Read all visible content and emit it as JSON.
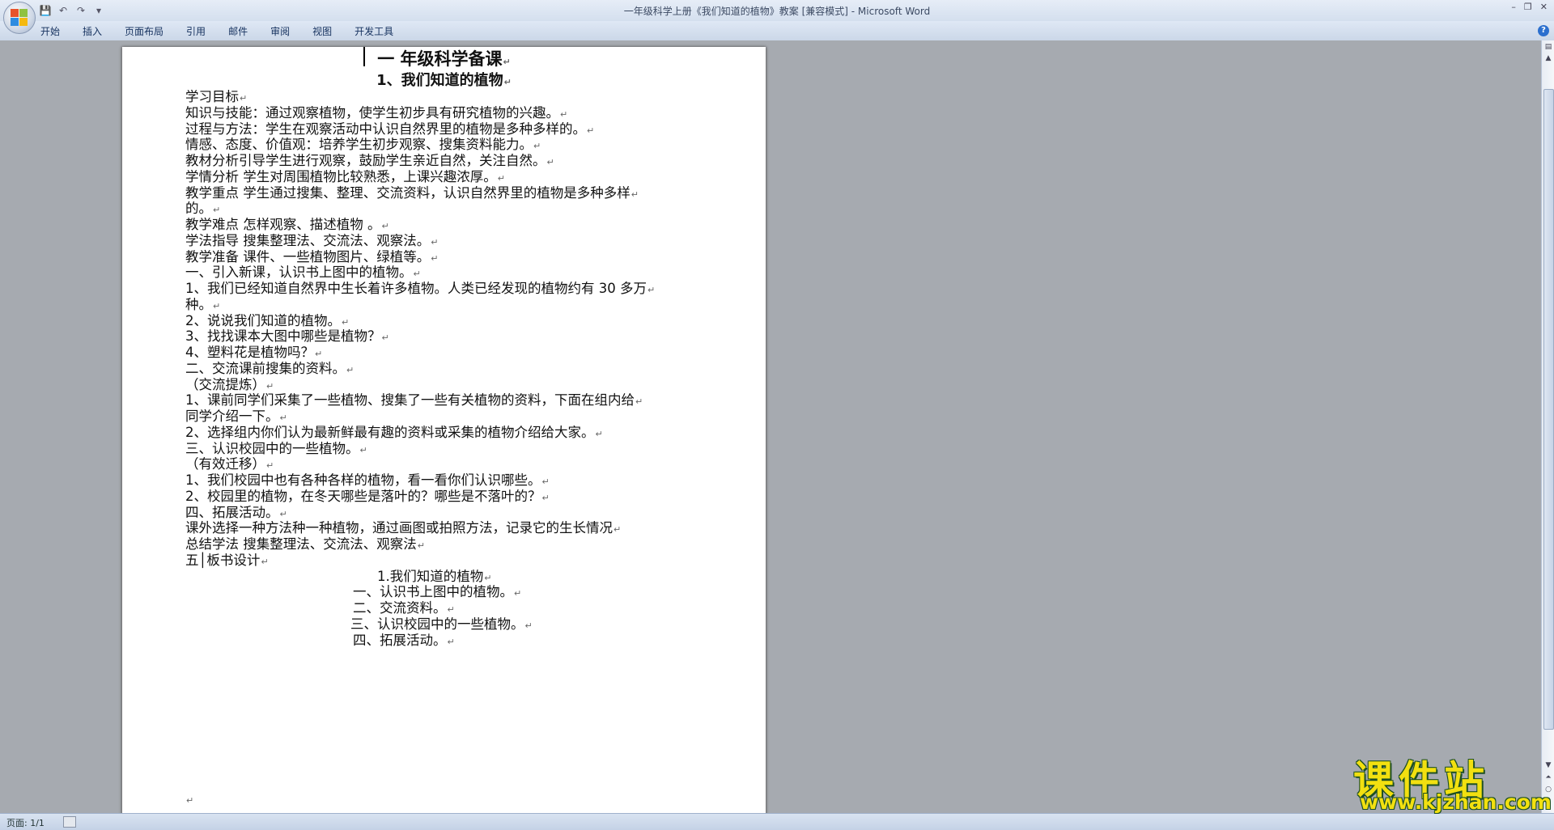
{
  "window": {
    "title": "一年级科学上册《我们知道的植物》教案 [兼容模式] - Microsoft Word"
  },
  "qat": {
    "icons": [
      "save-icon",
      "undo-icon",
      "redo-icon",
      "customize-icon"
    ]
  },
  "ribbon": {
    "tabs": [
      "开始",
      "插入",
      "页面布局",
      "引用",
      "邮件",
      "审阅",
      "视图",
      "开发工具"
    ]
  },
  "document": {
    "title1": "一 年级科学备课",
    "title2": "1、我们知道的植物",
    "lines": [
      "学习目标",
      "知识与技能：通过观察植物，使学生初步具有研究植物的兴趣。",
      "过程与方法：学生在观察活动中认识自然界里的植物是多种多样的。",
      "情感、态度、价值观：培养学生初步观察、搜集资料能力。",
      "教材分析引导学生进行观察，鼓励学生亲近自然，关注自然。",
      "学情分析 学生对周围植物比较熟悉，上课兴趣浓厚。",
      "教学重点 学生通过搜集、整理、交流资料，认识自然界里的植物是多种多样",
      "的。",
      "教学难点 怎样观察、描述植物 。",
      "学法指导 搜集整理法、交流法、观察法。",
      "教学准备 课件、一些植物图片、绿植等。",
      "一、引入新课，认识书上图中的植物。",
      "1、我们已经知道自然界中生长着许多植物。人类已经发现的植物约有 30 多万",
      "种。",
      "2、说说我们知道的植物。",
      "3、找找课本大图中哪些是植物？",
      "4、塑料花是植物吗？",
      "二、交流课前搜集的资料。",
      "（交流提炼）",
      "1、课前同学们采集了一些植物、搜集了一些有关植物的资料，下面在组内给",
      "同学介绍一下。",
      "2、选择组内你们认为最新鲜最有趣的资料或采集的植物介绍给大家。",
      "三、认识校园中的一些植物。",
      "（有效迁移）",
      "1、我们校园中也有各种各样的植物，看一看你们认识哪些。",
      "2、校园里的植物，在冬天哪些是落叶的？哪些是不落叶的？",
      "四、拓展活动。",
      "课外选择一种方法种一种植物，通过画图或拍照方法，记录它的生长情况",
      "总结学法 搜集整理法、交流法、观察法",
      "五│板书设计"
    ],
    "board": [
      "1.我们知道的植物",
      "一、认识书上图中的植物。",
      "二、交流资料。",
      "三、认识校园中的一些植物。",
      "四、拓展活动。"
    ],
    "paragraph_mark": "↵"
  },
  "status": {
    "page": "页面: 1/1"
  },
  "watermark": {
    "main": "课件站",
    "url": "www.kjzhan.com"
  }
}
